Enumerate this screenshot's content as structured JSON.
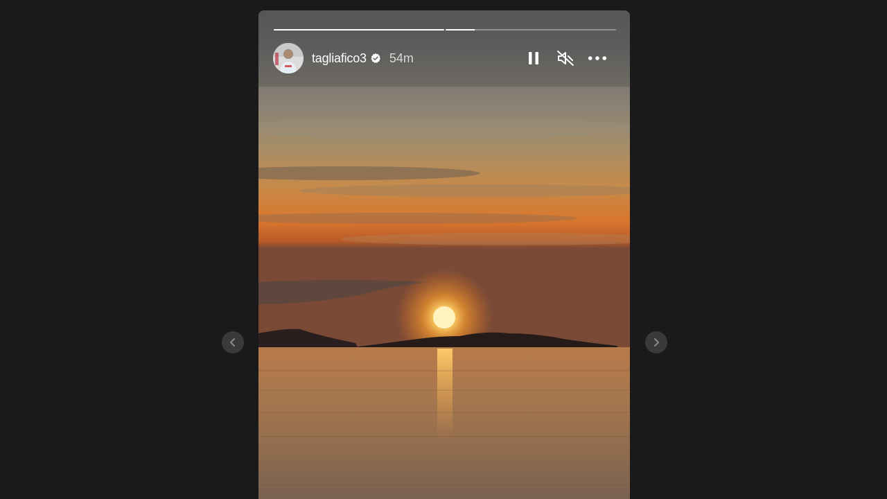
{
  "story": {
    "username": "tagliafico3",
    "time_ago": "54m",
    "verified": true,
    "progress": [
      1.0,
      0.17
    ],
    "media_description_icon": "sunset-photo"
  },
  "controls": {
    "pause_icon": "pause-icon",
    "mute_icon": "speaker-muted-icon",
    "more_icon": "more-horizontal-icon"
  },
  "navigation": {
    "prev_icon": "chevron-left-icon",
    "next_icon": "chevron-right-icon"
  },
  "colors": {
    "background": "#1a1a1a",
    "nav_button": "#3a3a3a",
    "progress_active": "#ffffff",
    "progress_inactive": "rgba(255,255,255,0.35)"
  }
}
